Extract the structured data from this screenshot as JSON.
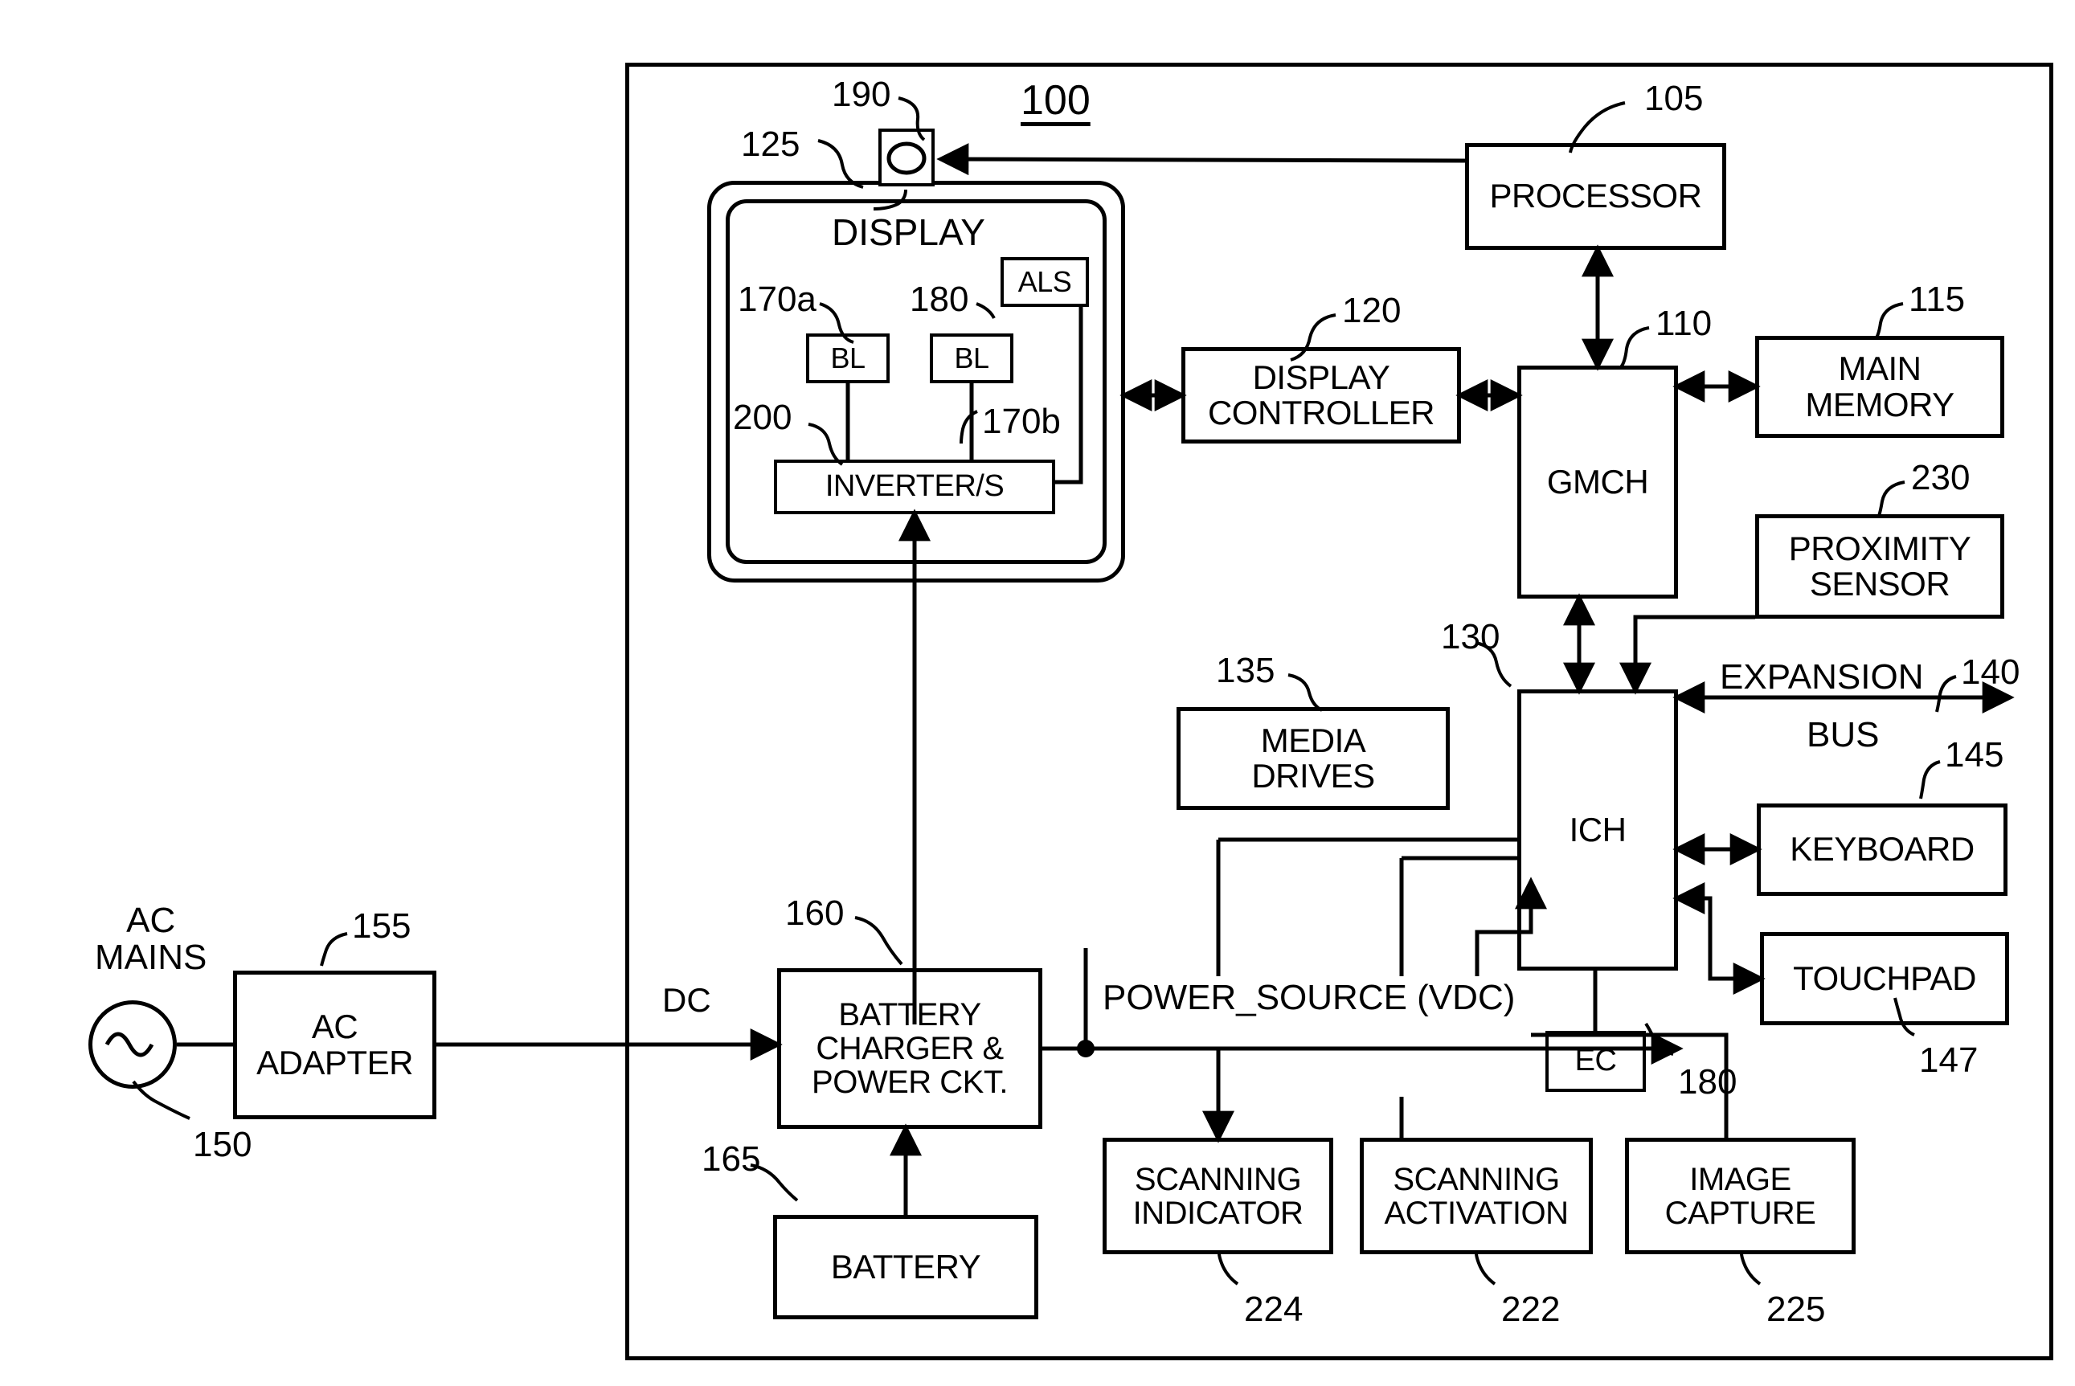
{
  "figure": {
    "system_ref": "100",
    "frame_label": "100"
  },
  "blocks": {
    "display_outer_ref": "125",
    "display_title": "DISPLAY",
    "camera_ref": "190",
    "als": "ALS",
    "als_ref": "180",
    "bl_a": "BL",
    "bl_a_ref": "170a",
    "bl_b": "BL",
    "bl_b_ref": "170b",
    "inverter": "INVERTER/S",
    "inverter_ref": "200",
    "display_controller": "DISPLAY\nCONTROLLER",
    "display_controller_ref": "120",
    "processor": "PROCESSOR",
    "processor_ref": "105",
    "gmch": "GMCH",
    "gmch_ref": "110",
    "main_memory": "MAIN\nMEMORY",
    "main_memory_ref": "115",
    "proximity_sensor": "PROXIMITY\nSENSOR",
    "proximity_sensor_ref": "230",
    "ich": "ICH",
    "ich_ref": "130",
    "media_drives": "MEDIA\nDRIVES",
    "media_drives_ref": "135",
    "expansion_bus_line1": "EXPANSION",
    "expansion_bus_line2": "BUS",
    "expansion_bus_ref": "140",
    "keyboard": "KEYBOARD",
    "keyboard_ref": "145",
    "touchpad": "TOUCHPAD",
    "touchpad_ref": "147",
    "ec": "EC",
    "ec_ref": "180",
    "ac_mains": "AC\nMAINS",
    "ac_mains_ref": "150",
    "ac_adapter": "AC\nADAPTER",
    "ac_adapter_ref": "155",
    "dc_label": "DC",
    "battery_charger": "BATTERY\nCHARGER &\nPOWER CKT.",
    "battery_charger_ref": "160",
    "battery": "BATTERY",
    "battery_ref": "165",
    "power_source_label": "POWER_SOURCE (VDC)",
    "scanning_indicator": "SCANNING\nINDICATOR",
    "scanning_indicator_ref": "224",
    "scanning_activation": "SCANNING\nACTIVATION",
    "scanning_activation_ref": "222",
    "image_capture": "IMAGE\nCAPTURE",
    "image_capture_ref": "225"
  },
  "colors": {
    "ink": "#000000",
    "paper": "#ffffff"
  }
}
